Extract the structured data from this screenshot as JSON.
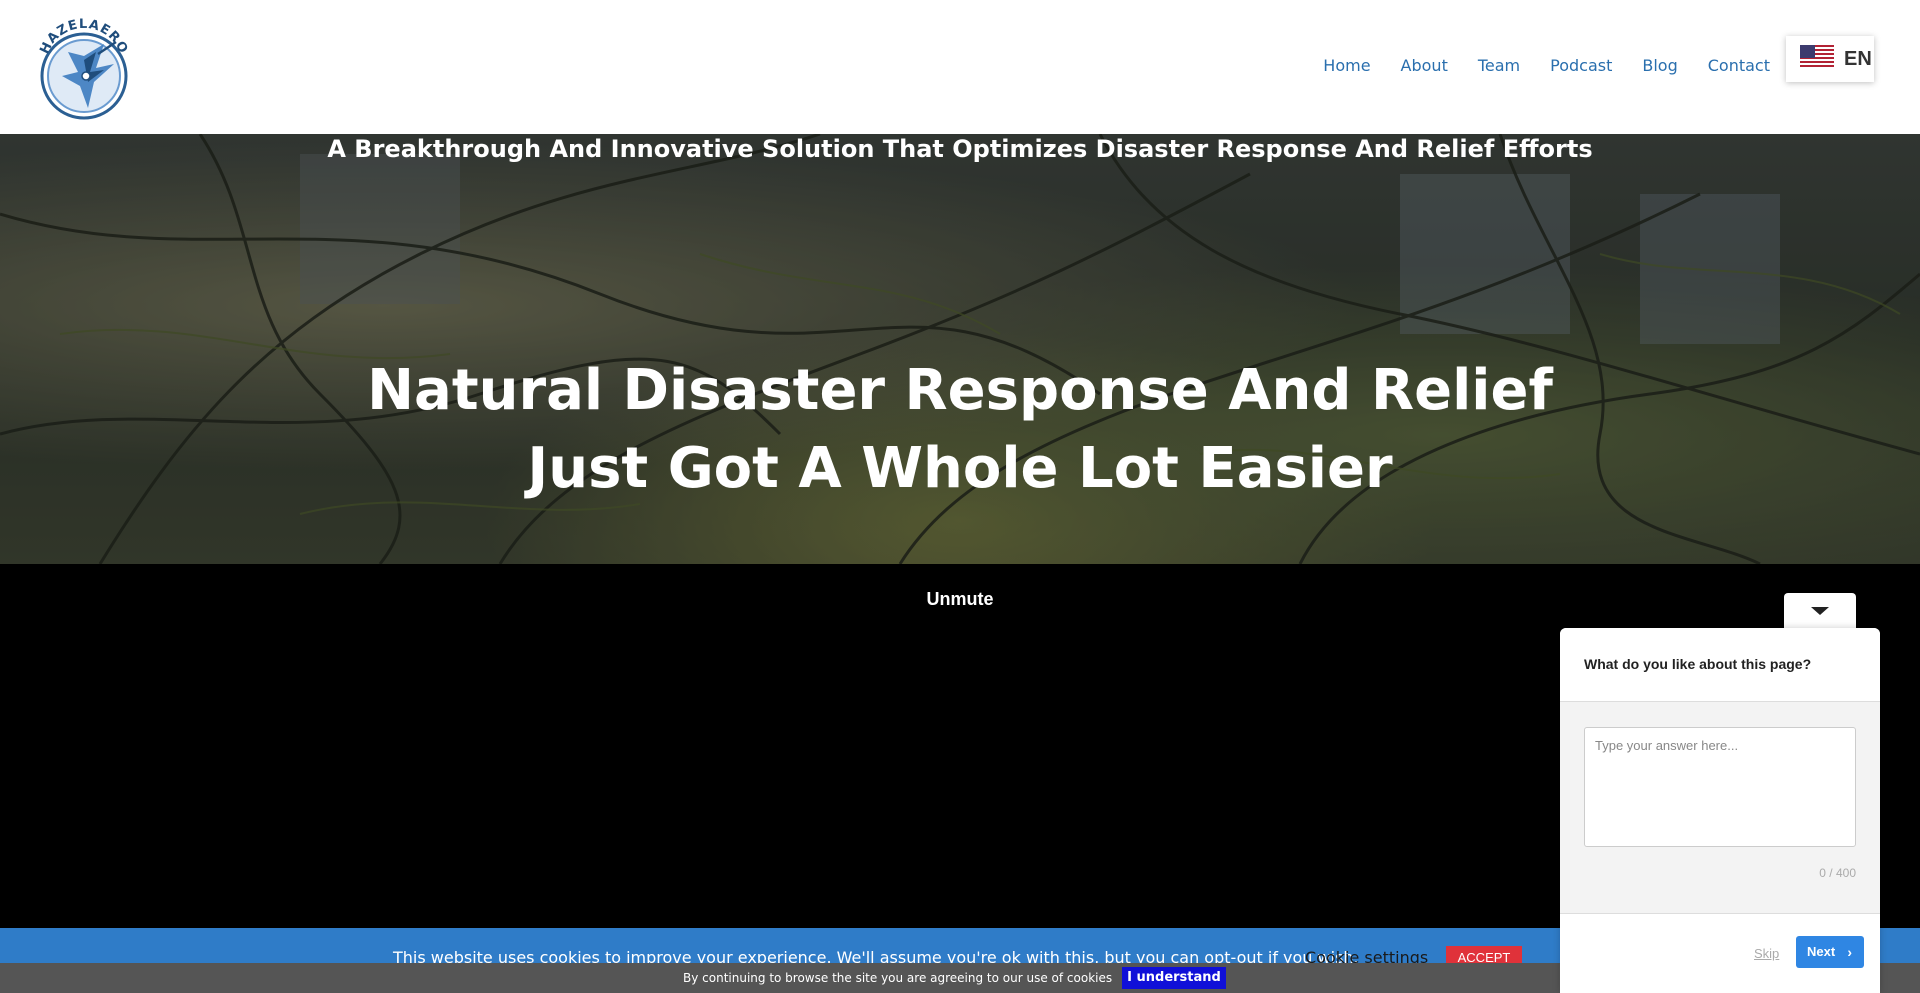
{
  "header": {
    "logo_text": "HAZELAERO",
    "nav": [
      "Home",
      "About",
      "Team",
      "Podcast",
      "Blog",
      "Contact"
    ],
    "language": {
      "label": "EN",
      "flag_icon": "us-flag-icon"
    }
  },
  "hero": {
    "subtitle": "A Breakthrough And Innovative Solution That Optimizes Disaster Response And Relief Efforts",
    "title_line1": "Natural Disaster Response And Relief",
    "title_line2": "Just Got A Whole Lot Easier"
  },
  "video": {
    "unmute_label": "Unmute"
  },
  "cookie": {
    "text": "This website uses cookies to improve your experience. We'll assume you're ok with this, but you can opt-out if you wish.",
    "settings_label": "Cookie settings",
    "accept_label": "ACCEPT"
  },
  "browse_notice": {
    "text": "By continuing to browse the site you are agreeing to our use of cookies",
    "button_label": "I understand"
  },
  "feedback": {
    "question": "What do you like about this page?",
    "placeholder": "Type your answer here...",
    "counter": "0 / 400",
    "skip_label": "Skip",
    "next_label": "Next"
  },
  "colors": {
    "nav_link": "#2a6fae",
    "cookie_bar": "#2f7cc8",
    "accept": "#e0323a",
    "understand": "#1010d8",
    "next": "#2f86e3"
  }
}
